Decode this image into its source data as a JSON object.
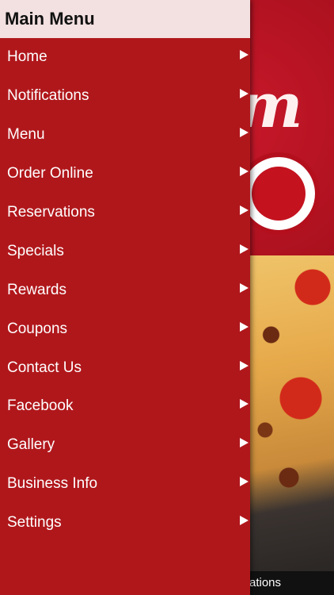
{
  "drawer": {
    "title": "Main Menu",
    "items": [
      {
        "label": "Home"
      },
      {
        "label": "Notifications"
      },
      {
        "label": "Menu"
      },
      {
        "label": "Order Online"
      },
      {
        "label": "Reservations"
      },
      {
        "label": "Specials"
      },
      {
        "label": "Rewards"
      },
      {
        "label": "Coupons"
      },
      {
        "label": "Contact Us"
      },
      {
        "label": "Facebook"
      },
      {
        "label": "Gallery"
      },
      {
        "label": "Business Info"
      },
      {
        "label": "Settings"
      }
    ],
    "arrow_icon": "triangle-right-icon"
  },
  "background": {
    "logo_text": "m",
    "bottom_label": "fications"
  },
  "colors": {
    "drawer_bg": "#b0171b",
    "header_bg": "#f3e0e0"
  }
}
